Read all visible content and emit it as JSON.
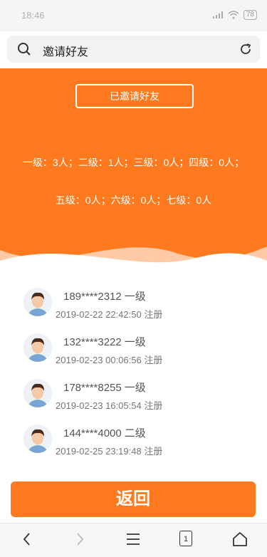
{
  "status_bar": {
    "time": "18:46",
    "battery": "78"
  },
  "search": {
    "text": "邀请好友"
  },
  "hero": {
    "button_label": "已邀请好友",
    "stats_line1": "一级：3人；二级：1人；三级：0人；四级：0人；",
    "stats_line2": "五级：0人；六级：0人；七级：0人"
  },
  "invites": [
    {
      "phone": "189****2312",
      "level": "一级",
      "time": "2019-02-22 22:42:50 注册"
    },
    {
      "phone": "132****3222",
      "level": "一级",
      "time": "2019-02-23 00:06:56 注册"
    },
    {
      "phone": "178****8255",
      "level": "一级",
      "time": "2019-02-23 16:05:54 注册"
    },
    {
      "phone": "144****4000",
      "level": "二级",
      "time": "2019-02-25 23:19:48 注册"
    }
  ],
  "back_button": {
    "label": "返回"
  },
  "nav": {
    "tab_count": "1"
  },
  "colors": {
    "accent": "#ff7a1e"
  }
}
